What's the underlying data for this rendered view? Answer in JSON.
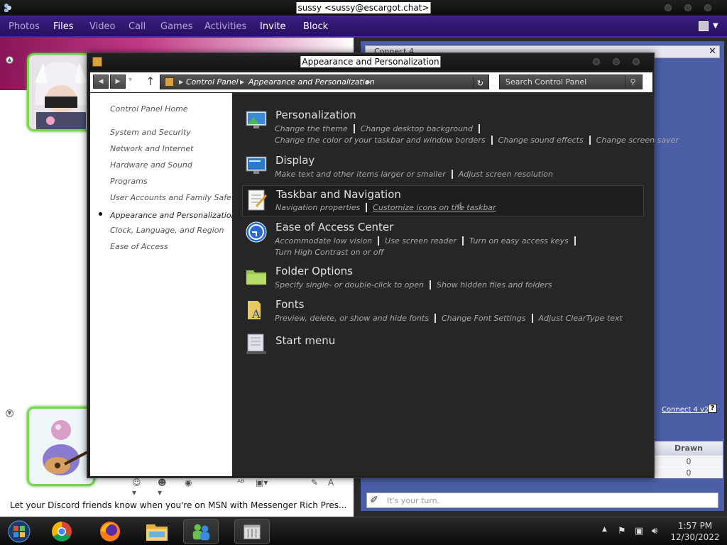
{
  "messenger": {
    "title": "sussy <sussy@escargot.chat>",
    "menu": [
      "Photos",
      "Files",
      "Video",
      "Call",
      "Games",
      "Activities",
      "Invite",
      "Block"
    ],
    "status_text": "Let your Discord friends know when you're on MSN with Messenger Rich Pres..."
  },
  "connect4": {
    "header": "Connect 4",
    "link": "Connect 4 v2.0",
    "help": "?",
    "table_header": "Drawn",
    "table_values": [
      "0",
      "0"
    ],
    "input_placeholder": "It's your turn."
  },
  "control_panel": {
    "title": "Appearance and Personalization",
    "breadcrumb": [
      "Control Panel",
      "Appearance and Personalization"
    ],
    "search_placeholder": "Search Control Panel",
    "sidebar": {
      "home": "Control Panel Home",
      "items": [
        "System and Security",
        "Network and Internet",
        "Hardware and Sound",
        "Programs",
        "User Accounts and Family Safety",
        "Appearance and Personalization",
        "Clock, Language, and Region",
        "Ease of Access"
      ]
    },
    "categories": [
      {
        "title": "Personalization",
        "icon": "personalization-icon",
        "links": [
          "Change the theme",
          "Change desktop background",
          "Change the color of your taskbar and window borders",
          "Change sound effects",
          "Change screen saver"
        ]
      },
      {
        "title": "Display",
        "icon": "display-icon",
        "links": [
          "Make text and other items larger or smaller",
          "Adjust screen resolution"
        ]
      },
      {
        "title": "Taskbar and Navigation",
        "icon": "taskbar-icon",
        "links": [
          "Navigation properties",
          "Customize icons on the taskbar"
        ]
      },
      {
        "title": "Ease of Access Center",
        "icon": "ease-of-access-icon",
        "links": [
          "Accommodate low vision",
          "Use screen reader",
          "Turn on easy access keys",
          "Turn High Contrast on or off"
        ]
      },
      {
        "title": "Folder Options",
        "icon": "folder-icon",
        "links": [
          "Specify single- or double-click to open",
          "Show hidden files and folders"
        ]
      },
      {
        "title": "Fonts",
        "icon": "fonts-icon",
        "links": [
          "Preview, delete, or show and hide fonts",
          "Change Font Settings",
          "Adjust ClearType text"
        ]
      },
      {
        "title": "Start menu",
        "icon": "start-menu-icon",
        "links": []
      }
    ]
  },
  "taskbar": {
    "time": "1:57 PM",
    "date": "12/30/2022",
    "apps": [
      "start-orb-icon",
      "chrome-icon",
      "firefox-icon",
      "file-explorer-icon",
      "messenger-icon",
      "control-panel-icon"
    ]
  }
}
